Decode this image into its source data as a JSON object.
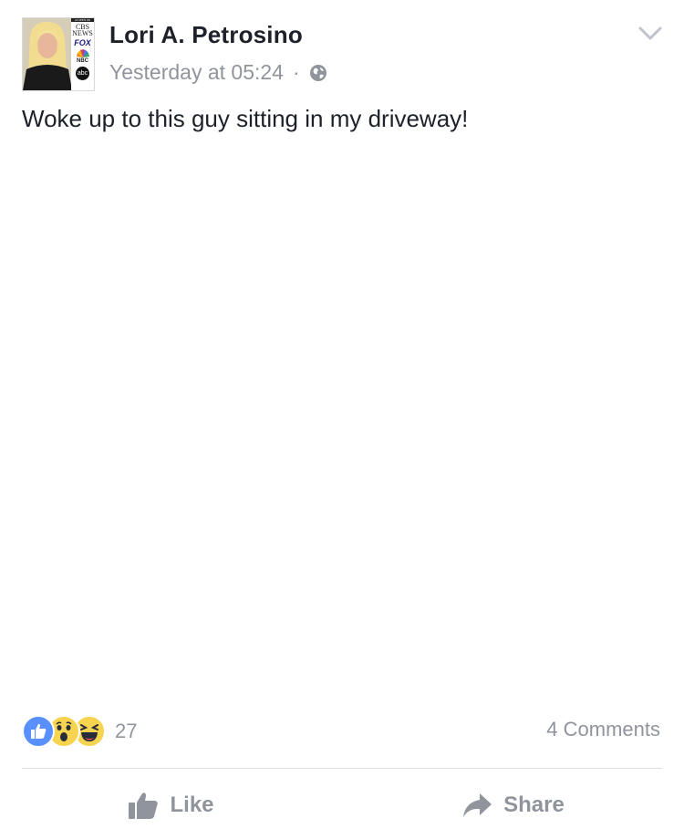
{
  "post": {
    "author": "Lori A. Petrosino",
    "timestamp": "Yesterday at 05:24",
    "separator": "·",
    "privacy_icon": "globe-icon",
    "text": "Woke up to this guy sitting in my driveway!"
  },
  "avatar": {
    "banner": "AS SEEN ON",
    "logo_cbs": "CBS NEWS",
    "logo_fox": "FOX",
    "logo_nbc": "NBC",
    "logo_abc": "abc"
  },
  "reactions": {
    "types": [
      "like-icon",
      "wow-icon",
      "haha-icon"
    ],
    "count": "27",
    "comments": "4 Comments"
  },
  "actions": {
    "like_label": "Like",
    "share_label": "Share"
  },
  "colors": {
    "text": "#1d2129",
    "meta": "#90949c",
    "like_blue": "#5890ff",
    "emoji_yellow": "#f7d44f"
  }
}
